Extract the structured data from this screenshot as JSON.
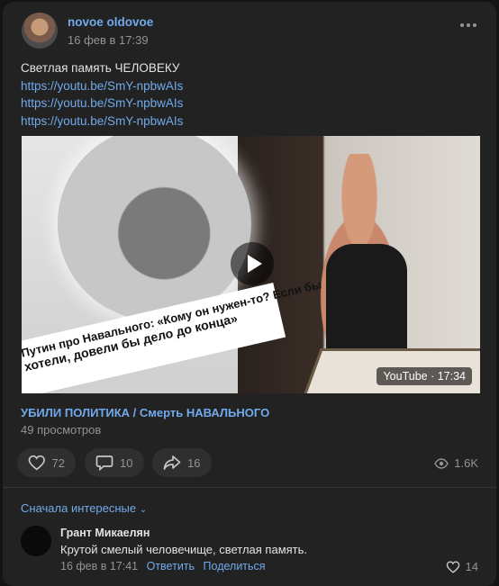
{
  "post": {
    "author": "novoe oldovoe",
    "date": "16 фев в 17:39",
    "text": "Светлая память ЧЕЛОВЕКУ",
    "links": [
      "https://youtu.be/SmY-npbwAIs",
      "https://youtu.be/SmY-npbwAIs",
      "https://youtu.be/SmY-npbwAIs"
    ]
  },
  "video": {
    "banner_line1": "Путин про Навального: «Кому он нужен-то? Если бы",
    "banner_line2": "хотели, довели бы дело до конца»",
    "badge": "YouTube · 17:34",
    "title": "УБИЛИ ПОЛИТИКА / Смерть НАВАЛЬНОГО",
    "views": "49 просмотров"
  },
  "actions": {
    "likes": "72",
    "comments": "10",
    "shares": "16",
    "views": "1.6K"
  },
  "comments": {
    "sort_label": "Сначала интересные",
    "items": [
      {
        "author": "Грант Микаелян",
        "text": "Крутой смелый человечище, светлая память.",
        "date": "16 фев в 17:41",
        "reply": "Ответить",
        "share": "Поделиться",
        "likes": "14"
      }
    ]
  },
  "colors": {
    "background": "#141414",
    "card": "#222222",
    "accent": "#71aaeb",
    "muted": "#939393"
  }
}
